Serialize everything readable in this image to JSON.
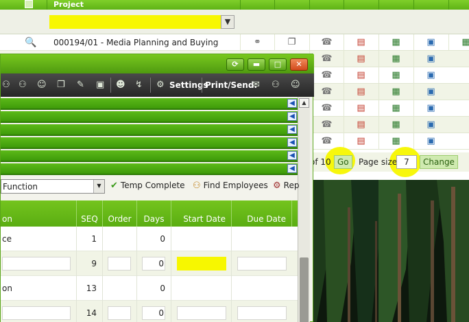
{
  "background_grid": {
    "header_title": "Project",
    "project_row": "000194/01 - Media Planning and Buying",
    "filter_icon": "filter-funnel-icon",
    "pager": {
      "of_text": "of 10",
      "go_label": "Go",
      "page_size_label": "Page size:",
      "page_size_value": "7",
      "change_label": "Change"
    }
  },
  "window": {
    "buttons": {
      "refresh": "⟳",
      "minimize": "▬",
      "maximize": "□",
      "close": "✕"
    },
    "toolbar": {
      "settings_label": "Settings",
      "print_label": "Print/Send:"
    },
    "action_bar": {
      "function_value": "Function",
      "temp_complete": "Temp Complete",
      "find_employees": "Find Employees",
      "rep": "Rep"
    },
    "table": {
      "columns": [
        "on",
        "SEQ",
        "Order",
        "Days",
        "Start Date",
        "Due Date"
      ],
      "rows": [
        {
          "name": "ce",
          "seq": "1",
          "days": "0",
          "editable": false
        },
        {
          "name": "",
          "seq": "9",
          "days": "0",
          "editable": true
        },
        {
          "name": "on",
          "seq": "13",
          "days": "0",
          "editable": false
        },
        {
          "name": "",
          "seq": "14",
          "days": "0",
          "editable": true
        }
      ]
    }
  },
  "colors": {
    "header_green": "#6bbf1e",
    "highlight": "#f7f700",
    "window_green": "#5aa51a"
  }
}
